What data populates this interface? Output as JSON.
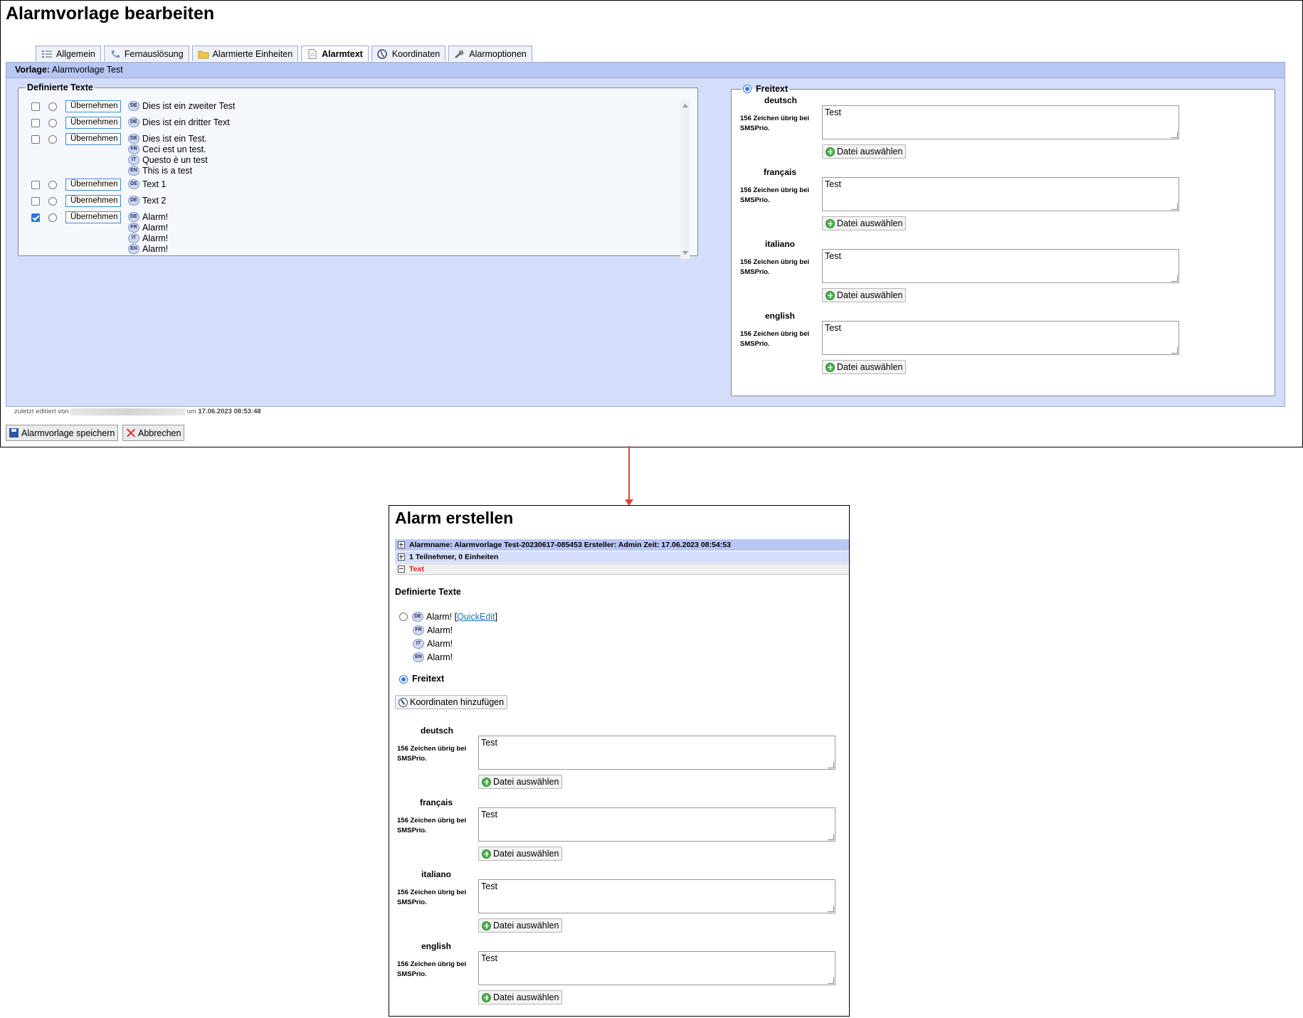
{
  "top": {
    "title": "Alarmvorlage bearbeiten",
    "tabs": [
      {
        "label": "Allgemein"
      },
      {
        "label": "Fernauslösung"
      },
      {
        "label": "Alarmierte Einheiten"
      },
      {
        "label": "Alarmtext",
        "active": true
      },
      {
        "label": "Koordinaten"
      },
      {
        "label": "Alarmoptionen"
      }
    ],
    "vorlage_label": "Vorlage:",
    "vorlage_value": "Alarmvorlage Test",
    "defined_texts": {
      "legend": "Definierte Texte",
      "button_label": "Übernehmen",
      "rows": [
        {
          "checked": false,
          "lines": [
            {
              "lang": "DE",
              "text": "Dies ist ein zweiter Test"
            }
          ]
        },
        {
          "checked": false,
          "lines": [
            {
              "lang": "DE",
              "text": "Dies ist ein dritter Text"
            }
          ]
        },
        {
          "checked": false,
          "lines": [
            {
              "lang": "DE",
              "text": "Dies ist ein Test."
            },
            {
              "lang": "FR",
              "text": "Ceci est un test."
            },
            {
              "lang": "IT",
              "text": "Questo è un test"
            },
            {
              "lang": "EN",
              "text": "This is a test"
            }
          ]
        },
        {
          "checked": false,
          "lines": [
            {
              "lang": "DE",
              "text": "Text 1"
            }
          ]
        },
        {
          "checked": false,
          "lines": [
            {
              "lang": "DE",
              "text": "Text 2"
            }
          ]
        },
        {
          "checked": true,
          "lines": [
            {
              "lang": "DE",
              "text": "Alarm!"
            },
            {
              "lang": "FR",
              "text": "Alarm!"
            },
            {
              "lang": "IT",
              "text": "Alarm!"
            },
            {
              "lang": "EN",
              "text": "Alarm!"
            }
          ]
        }
      ]
    },
    "freitext": {
      "legend": "Freitext",
      "languages": [
        {
          "name": "deutsch",
          "chars_info": "156 Zeichen übrig bei SMSPrio.",
          "value": "Test",
          "file_button": "Datei auswählen"
        },
        {
          "name": "français",
          "chars_info": "156 Zeichen übrig bei SMSPrio.",
          "value": "Test",
          "file_button": "Datei auswählen"
        },
        {
          "name": "italiano",
          "chars_info": "156 Zeichen übrig bei SMSPrio.",
          "value": "Test",
          "file_button": "Datei auswählen"
        },
        {
          "name": "english",
          "chars_info": "156 Zeichen übrig bei SMSPrio.",
          "value": "Test",
          "file_button": "Datei auswählen"
        }
      ]
    },
    "edited_prefix": "zuletzt editiert von",
    "edited_suffix": "um",
    "edited_time": "17.06.2023 08:53:48",
    "save_button": "Alarmvorlage speichern",
    "cancel_button": "Abbrechen"
  },
  "bottom": {
    "title": "Alarm erstellen",
    "bars": [
      "Alarmname: Alarmvorlage Test-20230617-085453 Ersteller: Admin Zeit: 17.06.2023 08:54:53",
      "1 Teilnehmer, 0 Einheiten",
      "Text"
    ],
    "defined_title": "Definierte Texte",
    "defined_lines": [
      {
        "lang": "DE",
        "text": "Alarm!"
      },
      {
        "lang": "FR",
        "text": "Alarm!"
      },
      {
        "lang": "IT",
        "text": "Alarm!"
      },
      {
        "lang": "EN",
        "text": "Alarm!"
      }
    ],
    "quickedit_open": "[",
    "quickedit_label": "QuickEdit",
    "quickedit_close": "]",
    "freitext_label": "Freitext",
    "koordinaten_button": "Koordinaten hinzufügen",
    "languages": [
      {
        "name": "deutsch",
        "chars_info": "156 Zeichen übrig bei SMSPrio.",
        "value": "Test",
        "file_button": "Datei auswählen"
      },
      {
        "name": "français",
        "chars_info": "156 Zeichen übrig bei SMSPrio.",
        "value": "Test",
        "file_button": "Datei auswählen"
      },
      {
        "name": "italiano",
        "chars_info": "156 Zeichen übrig bei SMSPrio.",
        "value": "Test",
        "file_button": "Datei auswählen"
      },
      {
        "name": "english",
        "chars_info": "156 Zeichen übrig bei SMSPrio.",
        "value": "Test",
        "file_button": "Datei auswählen"
      }
    ]
  },
  "colors": {
    "panel_bg": "#d4ddf9",
    "bar_bg": "#b8c6f4",
    "accent": "#2a78e8",
    "arrow": "#e0403c",
    "text_tab_label": "#dd2222"
  }
}
